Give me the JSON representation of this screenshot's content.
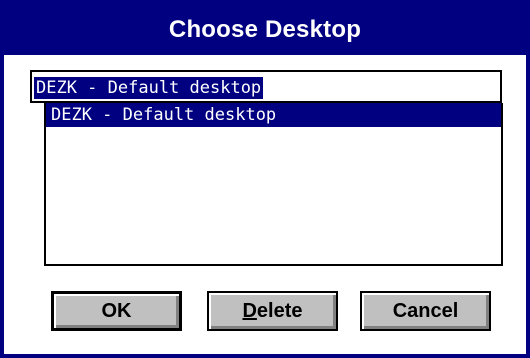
{
  "window": {
    "title": "Choose Desktop"
  },
  "edit": {
    "value": "DEZK - Default desktop"
  },
  "list": {
    "items": [
      {
        "label": "DEZK - Default desktop",
        "selected": true
      }
    ]
  },
  "buttons": {
    "ok_label": "OK",
    "delete_mnemonic": "D",
    "delete_rest": "elete",
    "cancel_label": "Cancel"
  },
  "colors": {
    "title_bar": "#000080",
    "selection": "#000080",
    "button_face": "#c0c0c0"
  }
}
